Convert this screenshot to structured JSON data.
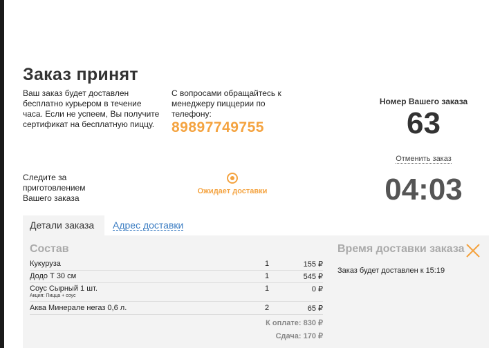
{
  "title": "Заказ принят",
  "delivery_note": "Ваш заказ будет доставлен бесплатно курьером в течение часа. Если не успеем, Вы получите сертификат на бесплатную пиццу.",
  "contact_note": "С вопросами обращайтесь к менеджеру пиццерии по телефону:",
  "phone": "89897749755",
  "order": {
    "label": "Номер Вашего заказа",
    "number": "63",
    "cancel_label": "Отменить заказ",
    "timer": "04:03"
  },
  "tracking": {
    "note": "Следите за приготовлением Вашего заказа",
    "status": "Ожидает доставки"
  },
  "tabs": {
    "details": "Детали заказа",
    "address": "Адрес доставки"
  },
  "composition": {
    "title": "Состав",
    "items": [
      {
        "name": "Кукуруза",
        "qty": "1",
        "price": "155 ₽",
        "promo": ""
      },
      {
        "name": "Додо Т 30 см",
        "qty": "1",
        "price": "545 ₽",
        "promo": ""
      },
      {
        "name": "Соус Сырный 1 шт.",
        "qty": "1",
        "price": "0 ₽",
        "promo": "Акция: Пицца + соус"
      },
      {
        "name": "Аква Минерале негаз 0,6 л.",
        "qty": "2",
        "price": "65 ₽",
        "promo": ""
      }
    ],
    "total": "К оплате: 830 ₽",
    "change": "Сдача: 170 ₽"
  },
  "delivery_time": {
    "title": "Время доставки заказа",
    "text": "Заказ будет доставлен к 15:19"
  },
  "colors": {
    "accent": "#f4a340",
    "link": "#3a7cc2"
  }
}
